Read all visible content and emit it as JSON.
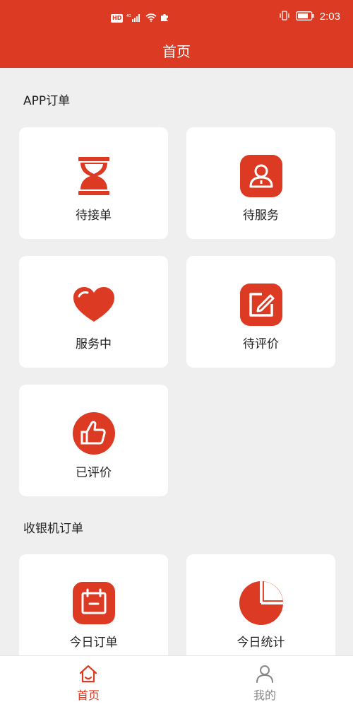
{
  "status_bar": {
    "hd_badge": "HD",
    "network": "4G",
    "time": "2:03"
  },
  "header": {
    "title": "首页"
  },
  "sections": {
    "app_orders": {
      "title": "APP订单",
      "items": [
        {
          "label": "待接单",
          "icon": "hourglass-icon"
        },
        {
          "label": "待服务",
          "icon": "person-icon"
        },
        {
          "label": "服务中",
          "icon": "heart-icon"
        },
        {
          "label": "待评价",
          "icon": "edit-icon"
        },
        {
          "label": "已评价",
          "icon": "thumbs-up-icon"
        }
      ]
    },
    "pos_orders": {
      "title": "收银机订单",
      "items": [
        {
          "label": "今日订单",
          "icon": "calendar-icon"
        },
        {
          "label": "今日统计",
          "icon": "pie-chart-icon"
        }
      ]
    }
  },
  "tabbar": {
    "tabs": [
      {
        "label": "首页",
        "icon": "home-icon",
        "active": true
      },
      {
        "label": "我的",
        "icon": "user-icon",
        "active": false
      }
    ]
  },
  "colors": {
    "accent": "#dd3a24",
    "inactive": "#888888",
    "background": "#efefef"
  }
}
